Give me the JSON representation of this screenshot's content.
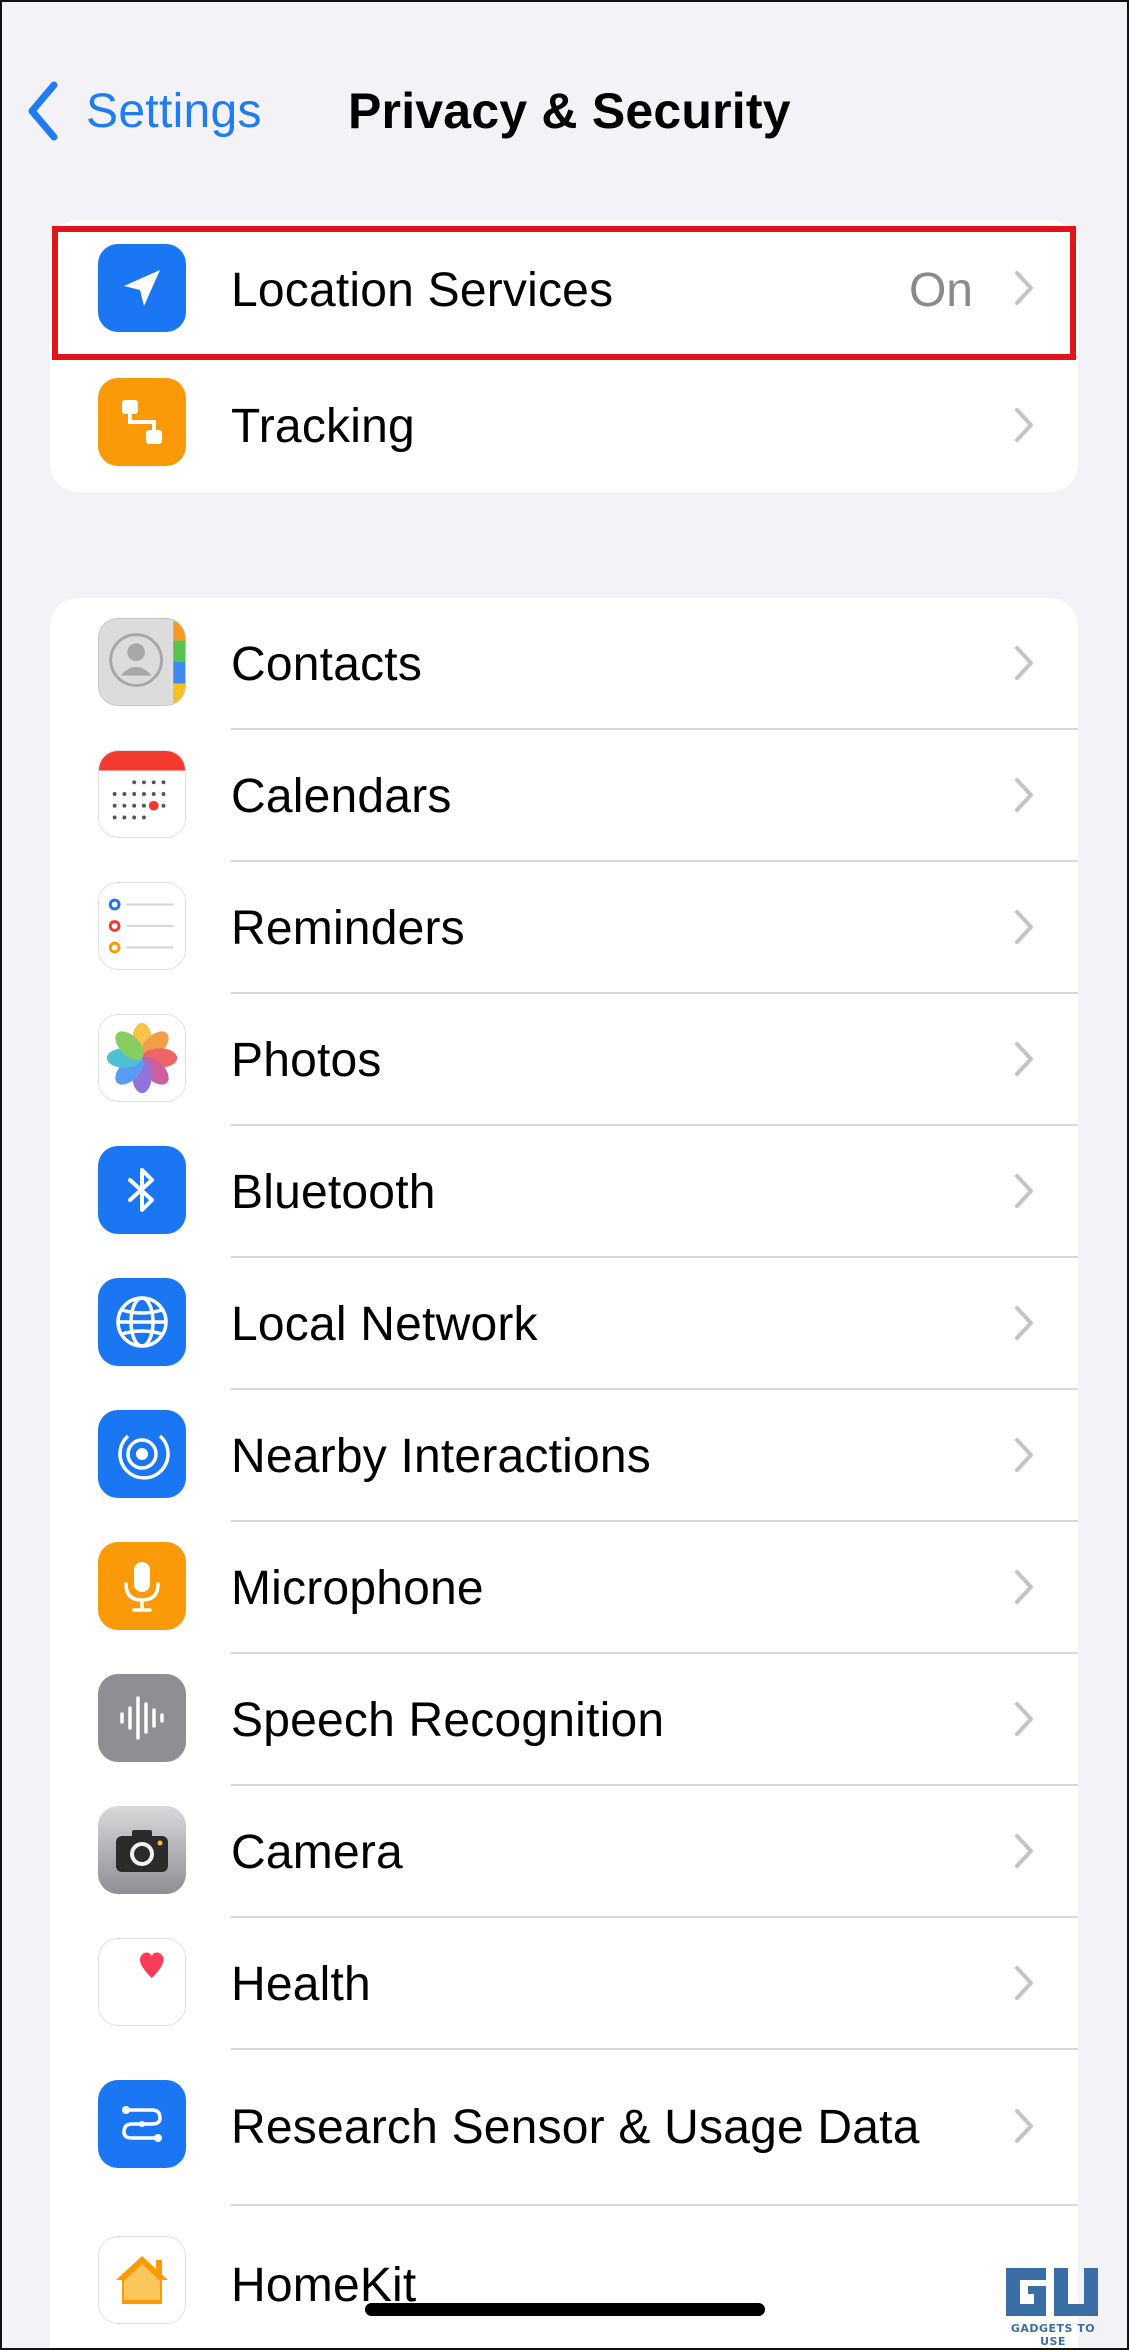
{
  "nav": {
    "back_label": "Settings",
    "title": "Privacy & Security"
  },
  "group1": [
    {
      "id": "location-services",
      "label": "Location Services",
      "value": "On",
      "icon": "location-arrow-icon",
      "color": "#1a76f2"
    },
    {
      "id": "tracking",
      "label": "Tracking",
      "icon": "tracking-icon",
      "color": "#fb9a09"
    }
  ],
  "group2": [
    {
      "id": "contacts",
      "label": "Contacts",
      "icon": "contacts-icon"
    },
    {
      "id": "calendars",
      "label": "Calendars",
      "icon": "calendar-icon"
    },
    {
      "id": "reminders",
      "label": "Reminders",
      "icon": "reminders-icon"
    },
    {
      "id": "photos",
      "label": "Photos",
      "icon": "photos-icon"
    },
    {
      "id": "bluetooth",
      "label": "Bluetooth",
      "icon": "bluetooth-icon",
      "color": "#1a76f2"
    },
    {
      "id": "local-network",
      "label": "Local Network",
      "icon": "globe-icon",
      "color": "#1a76f2"
    },
    {
      "id": "nearby-interactions",
      "label": "Nearby Interactions",
      "icon": "nearby-interactions-icon",
      "color": "#1a76f2"
    },
    {
      "id": "microphone",
      "label": "Microphone",
      "icon": "microphone-icon",
      "color": "#fb9a09"
    },
    {
      "id": "speech-recognition",
      "label": "Speech Recognition",
      "icon": "waveform-icon",
      "color": "#8e8e93"
    },
    {
      "id": "camera",
      "label": "Camera",
      "icon": "camera-icon",
      "color": "#8e8e93"
    },
    {
      "id": "health",
      "label": "Health",
      "icon": "heart-icon",
      "color": "#fb3c59"
    },
    {
      "id": "research-sensor",
      "label": "Research Sensor & Usage Data",
      "icon": "research-sensor-icon",
      "color": "#1a76f2"
    },
    {
      "id": "homekit",
      "label": "HomeKit",
      "icon": "home-icon",
      "color": "#fb9a09"
    }
  ],
  "colors": {
    "accent": "#1f7cf5",
    "highlight": "#e0141b",
    "background": "#f2f2f7"
  },
  "watermark": {
    "text": "GADGETS TO USE"
  }
}
